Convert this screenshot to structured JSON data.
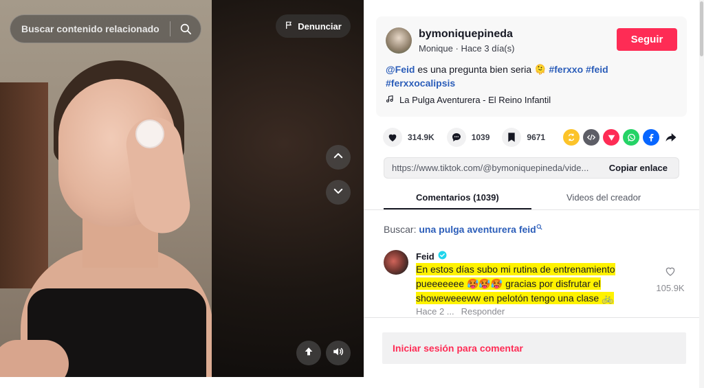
{
  "video": {
    "search_placeholder": "Buscar contenido relacionado",
    "report_label": "Denunciar"
  },
  "post": {
    "username": "bymoniquepineda",
    "display_name": "Monique",
    "separator": " · ",
    "time": "Hace 3 día(s)",
    "follow_label": "Seguir",
    "description": {
      "mention": "@Feid",
      "text": " es una pregunta bien seria 🫠 ",
      "tags": [
        "#ferxxo",
        "#feid",
        "#ferxxocalipsis"
      ]
    },
    "music": "La Pulga Aventurera - El Reino Infantil"
  },
  "stats": {
    "likes": "314.9K",
    "comments": "1039",
    "saves": "9671"
  },
  "share": {
    "icons": [
      "repost-icon",
      "embed-icon",
      "send-icon",
      "whatsapp-icon",
      "facebook-icon",
      "share-arrow-icon"
    ],
    "colors": [
      "#fcc329",
      "#5d5e66",
      "#fe2c55",
      "#25d366",
      "#0866ff",
      "#161823"
    ]
  },
  "link": {
    "url": "https://www.tiktok.com/@bymoniquepineda/vide...",
    "copy_label": "Copiar enlace"
  },
  "tabs": {
    "comments": "Comentarios (1039)",
    "videos": "Videos del creador"
  },
  "search": {
    "prefix": "Buscar:",
    "query": "una pulga aventurera feid"
  },
  "comment": {
    "author": "Feid",
    "verified": true,
    "lines": [
      "En estos días subo mi rutina de entrenamiento",
      "pueeeeeee 🥵🥵🥵 gracias por disfrutar el",
      "showeweeeww en pelotón tengo una clase 🚲"
    ],
    "time": "Hace 2 ...",
    "reply_label": "Responder",
    "likes": "105.9K"
  },
  "login": {
    "label": "Iniciar sesión para comentar"
  }
}
